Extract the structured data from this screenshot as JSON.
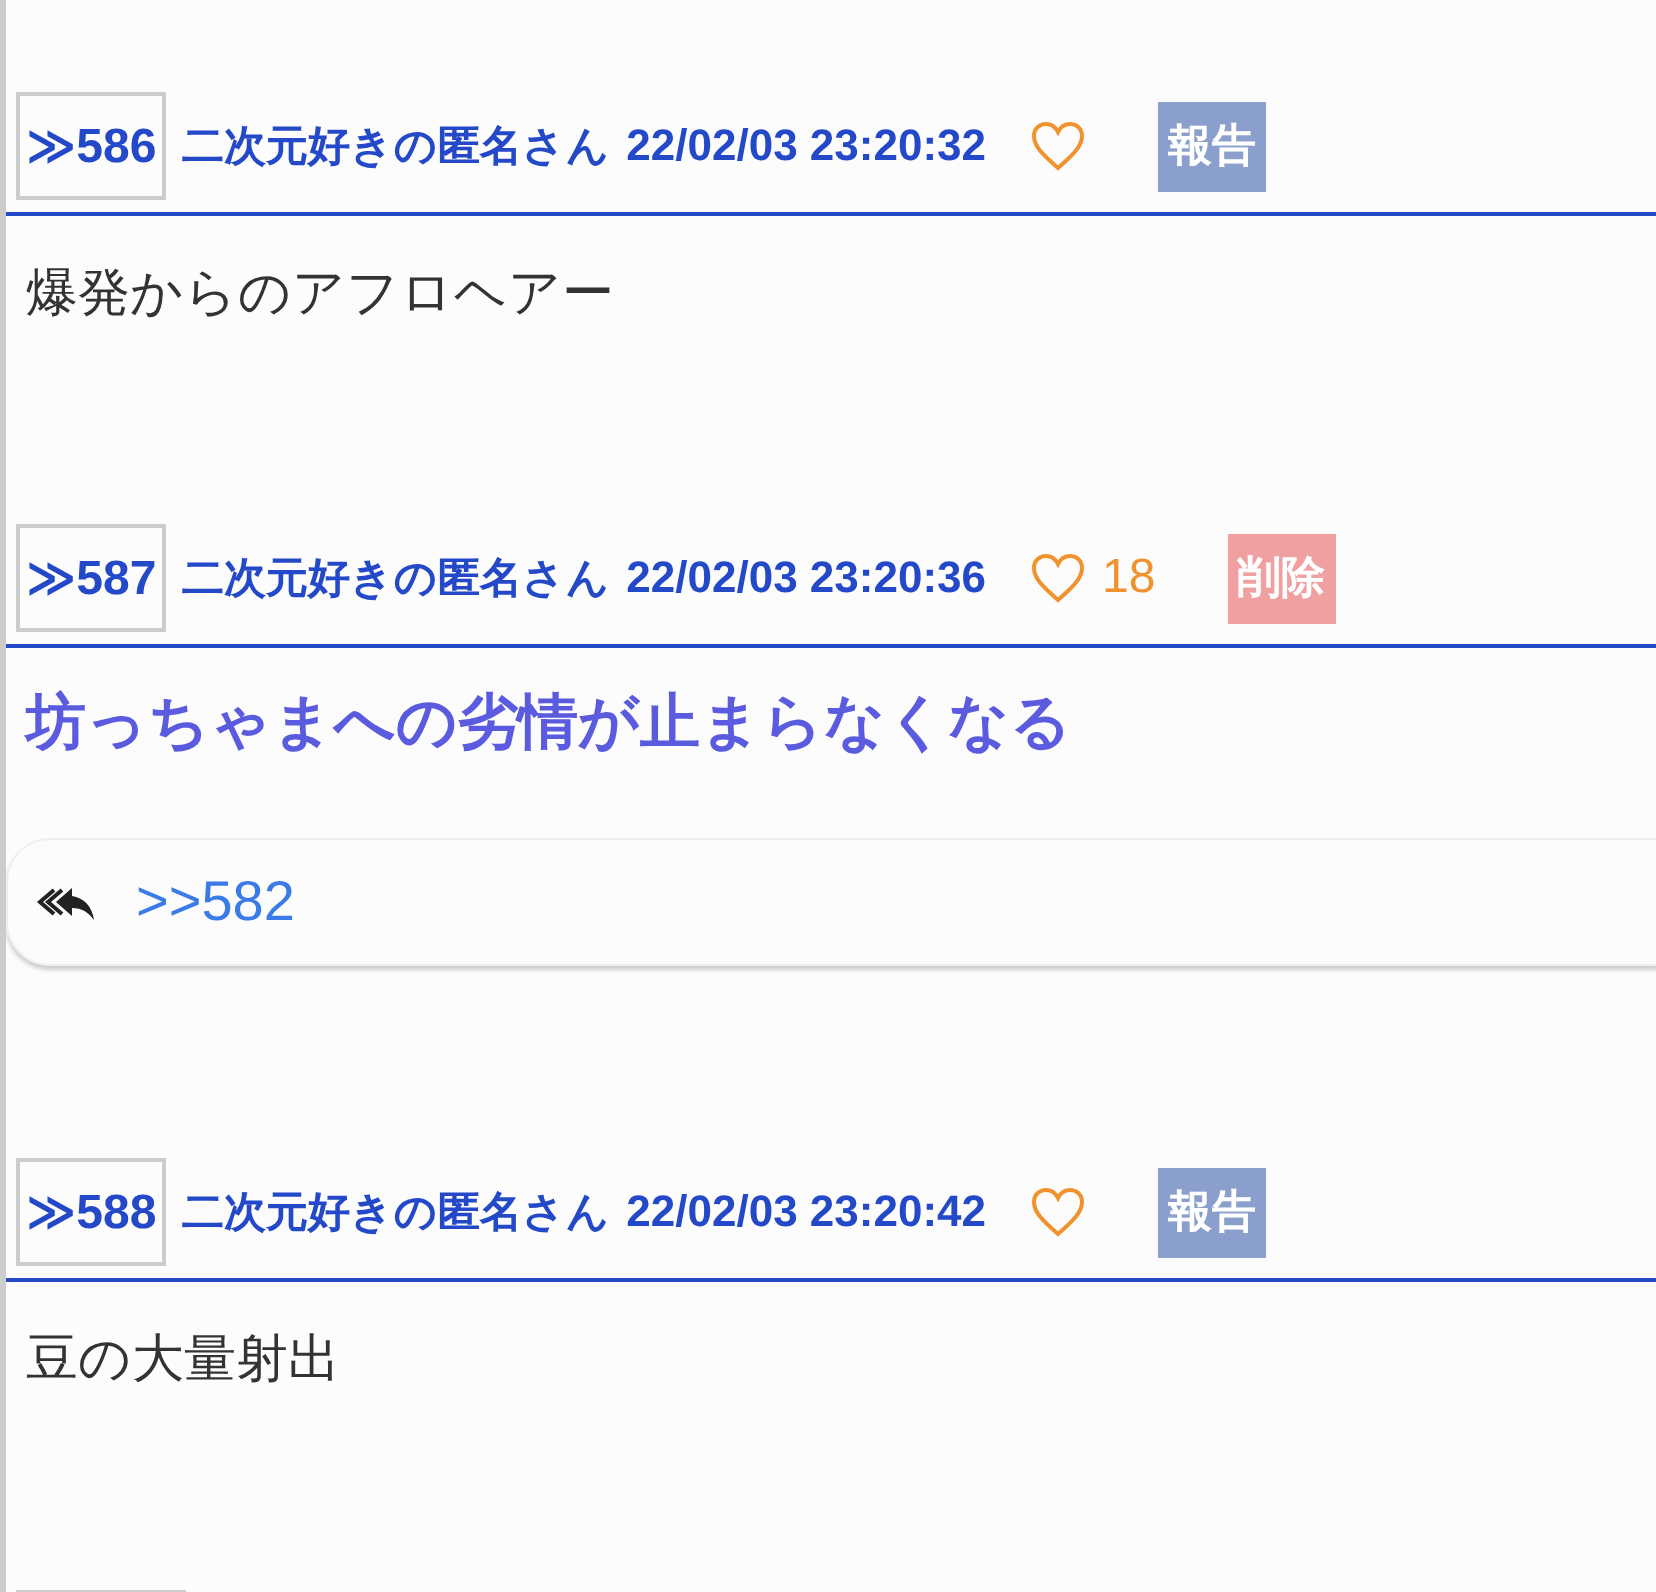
{
  "posts": [
    {
      "number": "≫586",
      "author": "二次元好きの匿名さん",
      "date": "22/02/03 23:20:32",
      "action": {
        "kind": "report",
        "label": "報告"
      },
      "body": {
        "kind": "plain",
        "text": "爆発からのアフロヘアー"
      }
    },
    {
      "number": "≫587",
      "author": "二次元好きの匿名さん",
      "date": "22/02/03 23:20:36",
      "like_count": "18",
      "action": {
        "kind": "delete",
        "label": "削除"
      },
      "body": {
        "kind": "emphasis",
        "text": "坊っちゃまへの劣情が止まらなくなる"
      },
      "reply": {
        "anchor": ">>582"
      }
    },
    {
      "number": "≫588",
      "author": "二次元好きの匿名さん",
      "date": "22/02/03 23:20:42",
      "action": {
        "kind": "report",
        "label": "報告"
      },
      "body": {
        "kind": "plain",
        "text": "豆の大量射出"
      }
    }
  ]
}
